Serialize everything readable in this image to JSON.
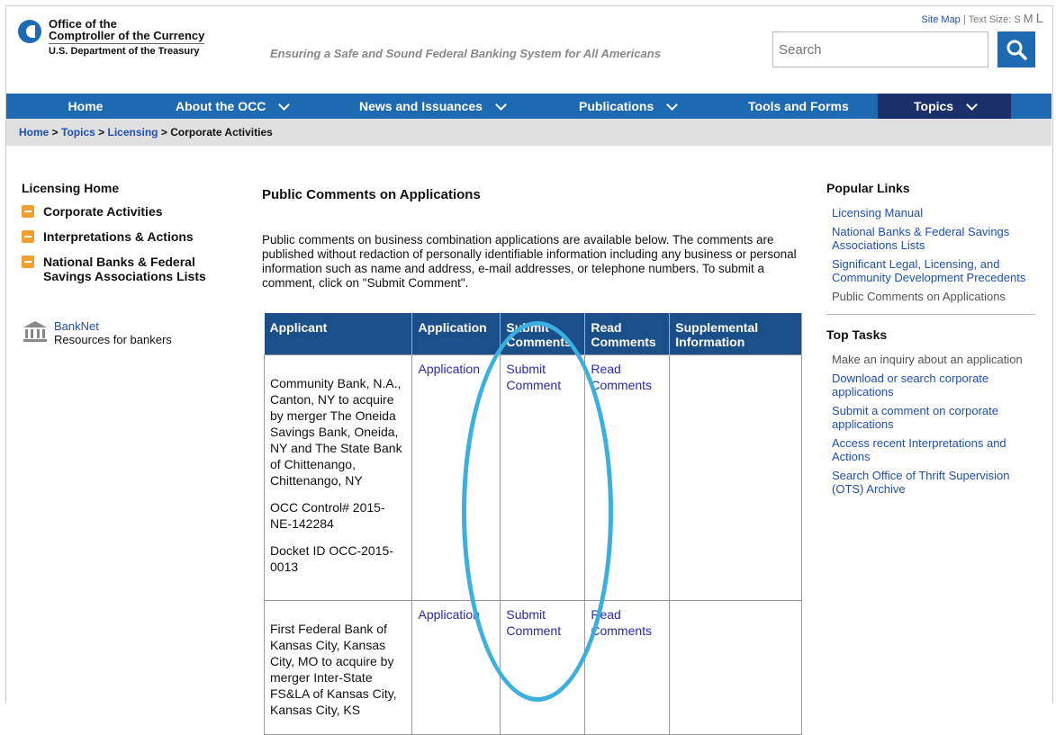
{
  "header": {
    "logo_line1": "Office of the",
    "logo_line2": "Comptroller of the Currency",
    "logo_line3": "U.S. Department of the Treasury",
    "tagline": "Ensuring a Safe and Sound Federal Banking System for All Americans",
    "site_map": "Site Map",
    "text_size_label": "Text Size:",
    "text_sizes": [
      "S",
      "M",
      "L"
    ],
    "search_placeholder": "Search"
  },
  "nav": [
    {
      "label": "Home"
    },
    {
      "label": "About the OCC"
    },
    {
      "label": "News and Issuances"
    },
    {
      "label": "Publications"
    },
    {
      "label": "Tools and Forms"
    },
    {
      "label": "Topics"
    }
  ],
  "breadcrumb": [
    "Home",
    "Topics",
    "Licensing",
    "Corporate Activities"
  ],
  "left": {
    "title": "Licensing Home",
    "items": [
      "Corporate Activities",
      "Interpretations & Actions",
      "National Banks & Federal Savings Associations Lists"
    ],
    "banknet_link": "BankNet",
    "banknet_desc": "Resources for bankers"
  },
  "main": {
    "title": "Public Comments on Applications",
    "intro": "Public comments on business combination applications are available below. The comments are published without redaction of personally identifiable information including any business or personal information such as name and address, e-mail addresses, or telephone numbers. To submit a comment, click on \"Submit Comment\".",
    "table": {
      "headers": [
        "Applicant",
        "Application",
        "Submit Comments",
        "Read Comments",
        "Supplemental Information"
      ],
      "rows": [
        {
          "applicant": "Community Bank, N.A., Canton, NY to acquire by merger The Oneida Savings Bank, Oneida, NY and The State Bank of Chittenango, Chittenango, NY",
          "control": "OCC Control# 2015-NE-142284",
          "docket": "Docket ID OCC-2015-0013",
          "application": "Application",
          "submit": "Submit Comment",
          "read": "Read Comments",
          "supplemental": ""
        },
        {
          "applicant": "First Federal Bank of Kansas City, Kansas City, MO to acquire by merger Inter-State FS&LA of Kansas City, Kansas City, KS",
          "control": "",
          "docket": "",
          "application": "Application",
          "submit": "Submit Comment",
          "read": "Read Comments",
          "supplemental": ""
        }
      ]
    }
  },
  "right": {
    "popular_title": "Popular Links",
    "popular": [
      "Licensing Manual",
      "National Banks & Federal Savings Associations Lists",
      "Significant Legal, Licensing, and Community Development Precedents",
      "Public Comments on Applications"
    ],
    "tasks_title": "Top Tasks",
    "tasks": [
      "Make an inquiry about an application",
      "Download or search corporate applications",
      "Submit a comment on corporate applications",
      "Access recent Interpretations and Actions",
      "Search Office of Thrift Supervision (OTS) Archive"
    ]
  },
  "colors": {
    "nav_blue": "#1d6ab3",
    "nav_active": "#1b2f6a",
    "annotation": "#39b0e0",
    "orange": "#f0a030"
  }
}
